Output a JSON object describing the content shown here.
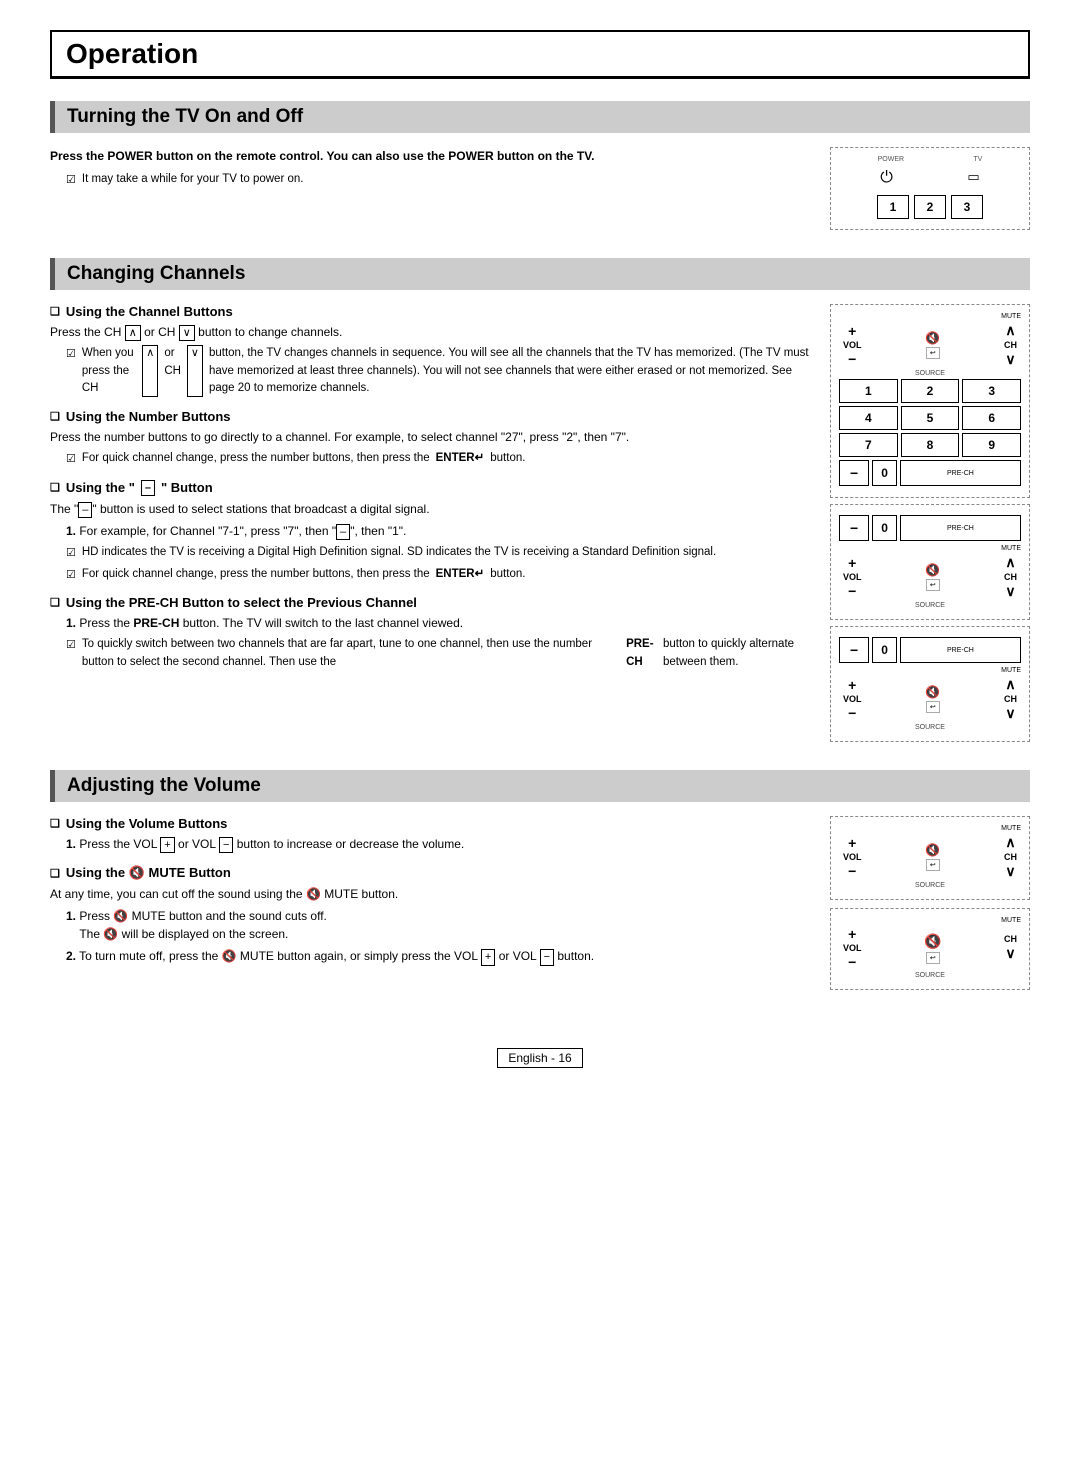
{
  "page": {
    "title": "Operation",
    "footer": "English - 16"
  },
  "sections": [
    {
      "id": "turning-on-off",
      "header": "Turning the TV On and Off",
      "intro_bold": "Press the POWER button on the remote control. You can also use the POWER button on the TV.",
      "notes": [
        "It may take a while for your TV to power on."
      ]
    },
    {
      "id": "changing-channels",
      "header": "Changing Channels",
      "subsections": [
        {
          "title": "Using the Channel Buttons",
          "body": "Press the CH ∧ or CH ∨ button to change channels.",
          "notes": [
            "When you press the CH ∧ or CH ∨ button, the TV changes channels in sequence. You will see all the channels that the TV has memorized. (The TV must have memorized at least three channels). You will not see channels that were either erased or not memorized. See page 20 to memorize channels."
          ]
        },
        {
          "title": "Using the Number Buttons",
          "body": "Press the number buttons to go directly to a channel. For example, to select channel \"27\", press \"2\", then \"7\".",
          "notes": [
            "For quick channel change, press the number buttons, then press the ENTER↵ button."
          ]
        },
        {
          "title": "Using the \"–\" Button",
          "body": "The \"–\" button is used to select stations that broadcast a digital signal.",
          "numbered": [
            "For example, for Channel \"7-1\", press \"7\", then \"–\", then \"1\"."
          ],
          "notes": [
            "HD indicates the TV is receiving a Digital High Definition signal. SD indicates the TV is receiving a Standard Definition signal.",
            "For quick channel change, press the number buttons, then press the ENTER↵ button."
          ]
        },
        {
          "title": "Using the PRE-CH Button to select the Previous Channel",
          "numbered": [
            "Press the PRE-CH button. The TV will switch to the last channel viewed."
          ],
          "notes": [
            "To quickly switch between two channels that are far apart, tune to one channel, then use the number button to select the second channel. Then use the PRE-CH button to quickly alternate between them."
          ]
        }
      ]
    },
    {
      "id": "adjusting-volume",
      "header": "Adjusting the Volume",
      "subsections": [
        {
          "title": "Using the Volume Buttons",
          "numbered": [
            "Press the VOL + or VOL – button to increase or decrease the volume."
          ]
        },
        {
          "title": "Using the 🔇 MUTE Button",
          "body": "At any time, you can cut off the sound using the 🔇 MUTE button.",
          "numbered": [
            "Press 🔇 MUTE button and the sound cuts off. The 🔇 will be displayed on the screen.",
            "To turn mute off, press the 🔇 MUTE button again, or simply press the VOL + or VOL – button."
          ]
        }
      ]
    }
  ]
}
